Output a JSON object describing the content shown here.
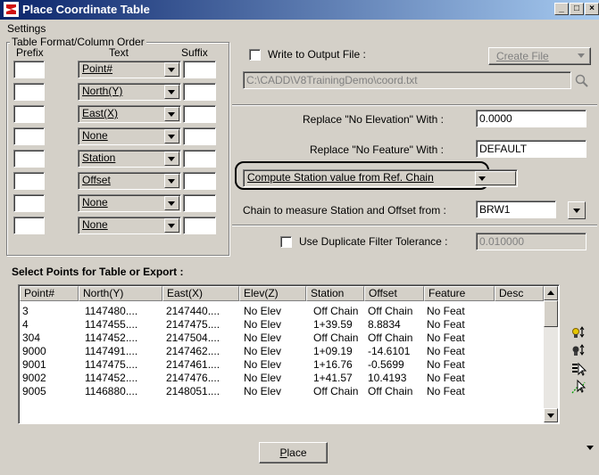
{
  "window": {
    "title": "Place Coordinate Table"
  },
  "menu": {
    "settings": "Settings"
  },
  "table_format": {
    "group_label": "Table Format/Column Order",
    "headers": {
      "prefix": "Prefix",
      "text": "Text",
      "suffix": "Suffix"
    },
    "rows": [
      {
        "text": "Point#"
      },
      {
        "text": "North(Y)"
      },
      {
        "text": "East(X)"
      },
      {
        "text": "None"
      },
      {
        "text": "Station"
      },
      {
        "text": "Offset"
      },
      {
        "text": "None"
      },
      {
        "text": "None"
      }
    ]
  },
  "output": {
    "write_label": "Write to Output File :",
    "create_file": "Create File",
    "file_path": "C:\\CADD\\V8TrainingDemo\\coord.txt"
  },
  "replace": {
    "elev_label": "Replace \"No Elevation\" With :",
    "elev_value": "0.0000",
    "feature_label": "Replace \"No Feature\" With :",
    "feature_value": "DEFAULT"
  },
  "compute": {
    "selected": "Compute Station value from Ref. Chain"
  },
  "chain": {
    "label": "Chain to measure Station and Offset from :",
    "value": "BRW1"
  },
  "duplicate": {
    "label": "Use Duplicate Filter Tolerance :",
    "value": "0.010000"
  },
  "points": {
    "heading": "Select Points for Table or Export :",
    "columns": [
      "Point#",
      "North(Y)",
      "East(X)",
      "Elev(Z)",
      "Station",
      "Offset",
      "Feature",
      "Desc"
    ],
    "rows": [
      [
        "3",
        "1147480....",
        "2147440....",
        "No Elev",
        "Off Chain",
        "Off Chain",
        "No Feat",
        ""
      ],
      [
        "4",
        "1147455....",
        "2147475....",
        "No Elev",
        "1+39.59",
        "8.8834",
        "No Feat",
        ""
      ],
      [
        "304",
        "1147452....",
        "2147504....",
        "No Elev",
        "Off Chain",
        "Off Chain",
        "No Feat",
        ""
      ],
      [
        "9000",
        "1147491....",
        "2147462....",
        "No Elev",
        "1+09.19",
        "-14.6101",
        "No Feat",
        ""
      ],
      [
        "9001",
        "1147475....",
        "2147461....",
        "No Elev",
        "1+16.76",
        "-0.5699",
        "No Feat",
        ""
      ],
      [
        "9002",
        "1147452....",
        "2147476....",
        "No Elev",
        "1+41.57",
        "10.4193",
        "No Feat",
        ""
      ],
      [
        "9005",
        "1146880....",
        "2148051....",
        "No Elev",
        "Off Chain",
        "Off Chain",
        "No Feat",
        ""
      ]
    ]
  },
  "place_button": "Place",
  "colors": {
    "titlebar_start": "#0a246a",
    "titlebar_end": "#a6caf0",
    "dialog_bg": "#d4d0c8"
  }
}
